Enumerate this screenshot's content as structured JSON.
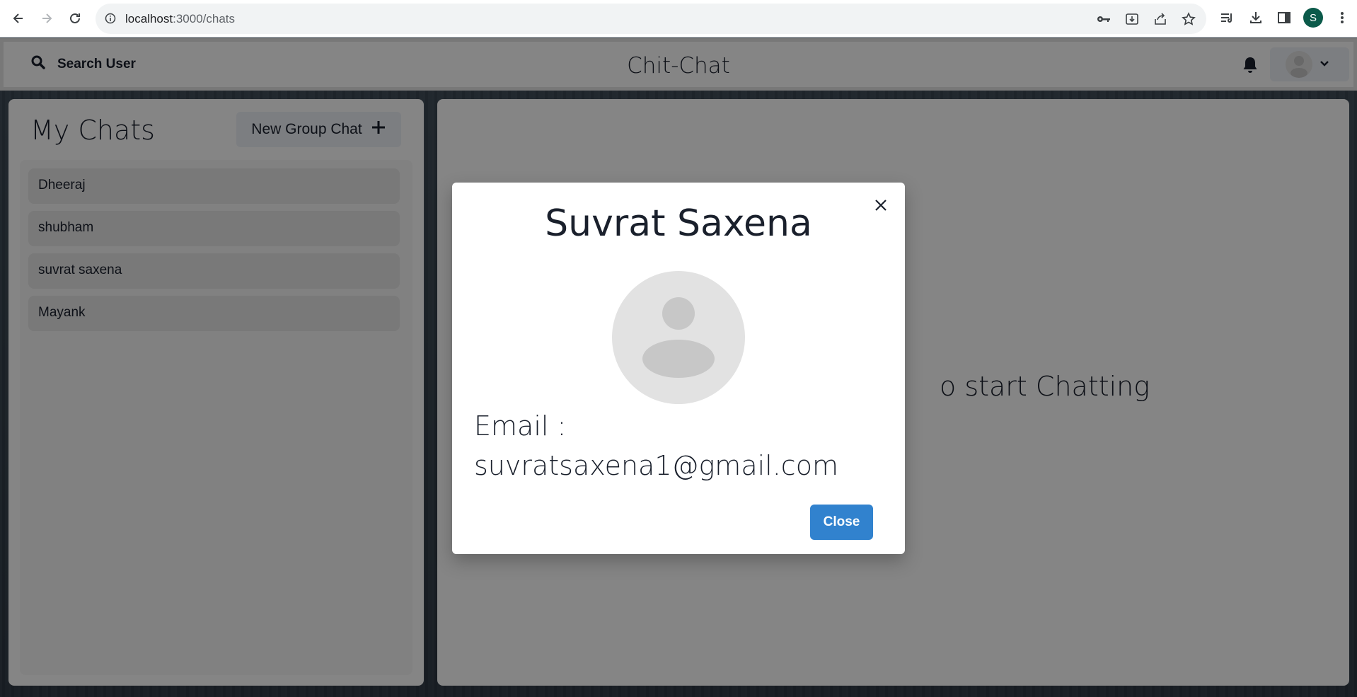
{
  "browser": {
    "url_host": "localhost",
    "url_path": ":3000/chats",
    "profile_initial": "S",
    "icons": [
      "back-icon",
      "forward-icon",
      "reload-icon",
      "info-icon",
      "key-icon",
      "install-icon",
      "share-icon",
      "star-icon",
      "reading-list-icon",
      "download-icon",
      "side-panel-icon",
      "more-icon"
    ]
  },
  "header": {
    "search_label": "Search User",
    "title": "Chit-Chat"
  },
  "sidebar": {
    "title": "My Chats",
    "new_group_label": "New Group Chat",
    "chats": [
      {
        "label": "Dheeraj"
      },
      {
        "label": "shubham"
      },
      {
        "label": "suvrat saxena"
      },
      {
        "label": "Mayank"
      }
    ]
  },
  "main": {
    "placeholder_tail": "o start Chatting"
  },
  "modal": {
    "title": "Suvrat Saxena",
    "email_label": "Email :",
    "email": "suvratsaxena1@gmail.com",
    "close_label": "Close"
  },
  "colors": {
    "accent": "#3182ce",
    "overlay": "rgba(0,0,0,0.48)",
    "profile_badge": "#0b5a4a"
  }
}
